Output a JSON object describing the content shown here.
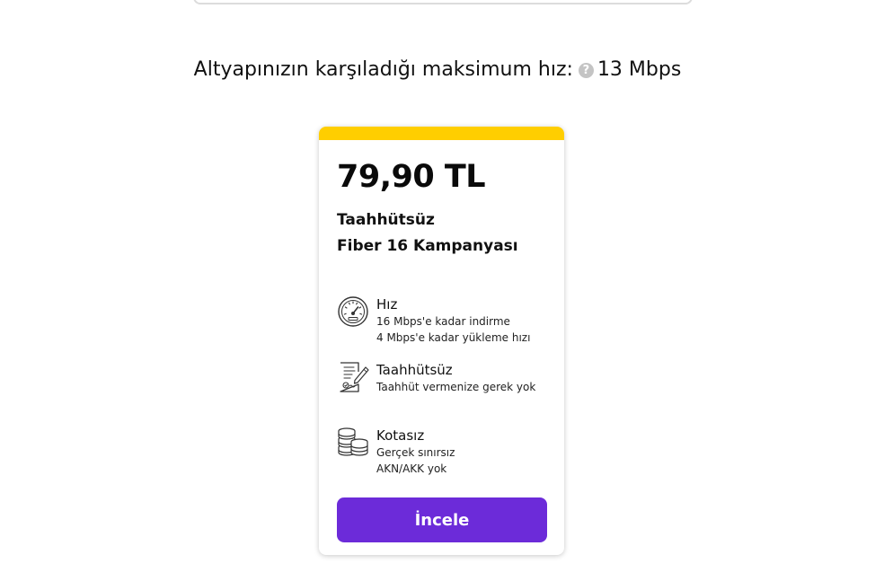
{
  "speed_info": {
    "label": "Altyapınızın karşıladığı maksimum hız:",
    "help_icon": "question-circle-icon",
    "value": "13 Mbps"
  },
  "card": {
    "accent_color": "#ffce00",
    "price": "79,90 TL",
    "plan_name_line1": "Taahhütsüz",
    "plan_name_line2": "Fiber 16 Kampanyası",
    "features": [
      {
        "icon": "speedometer-icon",
        "title": "Hız",
        "desc_line1": "16 Mbps'e kadar indirme",
        "desc_line2": "4 Mbps'e kadar yükleme hızı"
      },
      {
        "icon": "contract-icon",
        "title": "Taahhütsüz",
        "desc_line1": "Taahhüt vermenize gerek yok",
        "desc_line2": ""
      },
      {
        "icon": "coins-stack-icon",
        "title": "Kotasız",
        "desc_line1": "Gerçek sınırsız",
        "desc_line2": "AKN/AKK yok"
      }
    ],
    "button_label": "İncele",
    "button_color": "#6c2bd9"
  }
}
